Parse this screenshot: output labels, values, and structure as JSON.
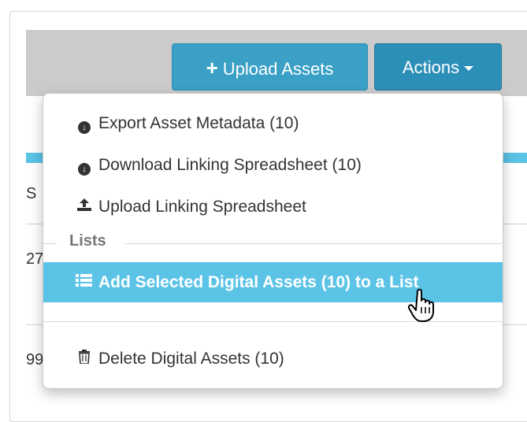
{
  "toolbar": {
    "upload_label": "Upload Assets",
    "upload_icon": "plus-icon",
    "actions_label": "Actions",
    "actions_icon": "caret-down-icon"
  },
  "background": {
    "row_fragments": [
      "S",
      "27",
      "99"
    ]
  },
  "menu": {
    "items": [
      {
        "label": "Export Asset Metadata (10)",
        "icon": "circle-arrow-down-icon"
      },
      {
        "label": "Download Linking Spreadsheet (10)",
        "icon": "circle-arrow-down-icon"
      },
      {
        "label": "Upload Linking Spreadsheet",
        "icon": "upload-icon"
      }
    ],
    "section_label": "Lists",
    "list_item": {
      "label": "Add Selected Digital Assets (10) to a List",
      "icon": "list-icon"
    },
    "delete_item": {
      "label": "Delete Digital Assets (10)",
      "icon": "trash-icon"
    }
  },
  "colors": {
    "primary_button": "#3aa0c6",
    "actions_button": "#2c8fb7",
    "highlight": "#5bc3e6",
    "toolbar_bg": "#cbcbcb"
  }
}
